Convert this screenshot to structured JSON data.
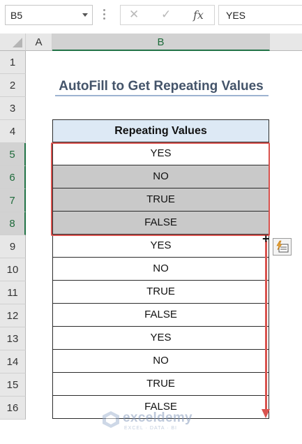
{
  "formula_bar": {
    "name_box": "B5",
    "cancel_icon": "x-icon",
    "enter_icon": "check-icon",
    "function_icon": "fx",
    "formula_value": "YES"
  },
  "columns": [
    "A",
    "B"
  ],
  "rows": [
    "1",
    "2",
    "3",
    "4",
    "5",
    "6",
    "7",
    "8",
    "9",
    "10",
    "11",
    "12",
    "13",
    "14",
    "15",
    "16"
  ],
  "selected_rows": [
    "5",
    "6",
    "7",
    "8"
  ],
  "title": "AutoFill to Get Repeating Values",
  "table": {
    "header": "Repeating Values",
    "values": [
      "YES",
      "NO",
      "TRUE",
      "FALSE",
      "YES",
      "NO",
      "TRUE",
      "FALSE",
      "YES",
      "NO",
      "TRUE",
      "FALSE"
    ]
  },
  "colors": {
    "selection_border": "#d9534f",
    "header_fill": "#dde9f5",
    "selected_fill": "#c9c9c9",
    "title_color": "#44546a"
  },
  "watermark": {
    "name": "exceldemy",
    "tagline": "EXCEL · DATA · BI"
  }
}
